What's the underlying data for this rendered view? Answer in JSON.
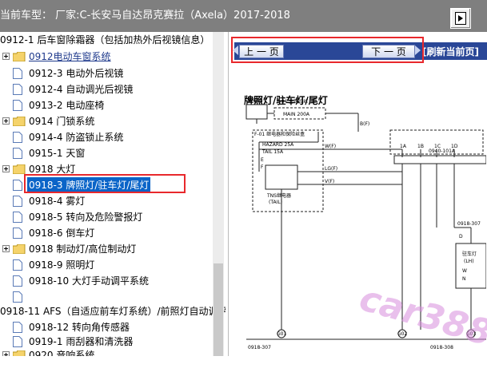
{
  "header": {
    "title": "当前车型： 厂家:C-长安马自达昂克赛拉（Axela）2017-2018",
    "action_icon": "page-export-icon"
  },
  "tree": {
    "items": [
      {
        "label": "0912-1 后车窗除霜器（包括加热外后视镜信息）",
        "type": "doc"
      },
      {
        "label": "0912电动车窗系统",
        "type": "folder"
      },
      {
        "label": "0912-3 电动外后视镜",
        "type": "doc"
      },
      {
        "label": "0912-4 自动调光后视镜",
        "type": "doc"
      },
      {
        "label": "0913-2 电动座椅",
        "type": "doc"
      },
      {
        "label": "0914 门锁系统",
        "type": "folder"
      },
      {
        "label": "0914-4 防盗锁止系统",
        "type": "doc"
      },
      {
        "label": "0915-1 天窗",
        "type": "doc"
      },
      {
        "label": "0918 大灯",
        "type": "folder"
      },
      {
        "label": "0918-3 牌照灯/驻车灯/尾灯",
        "type": "doc",
        "selected": true
      },
      {
        "label": "0918-4 雾灯",
        "type": "doc"
      },
      {
        "label": "0918-5 转向及危险警报灯",
        "type": "doc"
      },
      {
        "label": "0918-6 倒车灯",
        "type": "doc"
      },
      {
        "label": "0918 制动灯/高位制动灯",
        "type": "folder"
      },
      {
        "label": "0918-9 照明灯",
        "type": "doc"
      },
      {
        "label": "0918-10 大灯手动调平系统",
        "type": "doc"
      },
      {
        "label": "",
        "type": "doc"
      },
      {
        "label": "0918-11 AFS（自适应前车灯系统）/前照灯自动调平",
        "type": "none"
      },
      {
        "label": "0918-12 转向角传感器",
        "type": "doc"
      },
      {
        "label": "0919-1 雨刮器和清洗器",
        "type": "doc"
      },
      {
        "label": "0920 音响系统",
        "type": "folder"
      }
    ]
  },
  "viewer": {
    "prev_label": "上 一 页",
    "next_label": "下 一 页",
    "refresh_label": "[刷新当前页]",
    "diagram": {
      "title": "牌照灯/驻车灯/尾灯",
      "labels": {
        "battery": "蓄电池",
        "main_fuse": "F-04 主保险丝",
        "main_fuse_rating": "MAIN 200A",
        "fuse_block": "F-01 继电器和保险丝盒",
        "hazard": "HAZARD 25A",
        "tail": "TAIL 15A",
        "relay": "TNS继电器",
        "relay_sub": "(TAIL)",
        "wire_b": "B(F)",
        "wire_w": "W(F)",
        "wire_lg": "LG(F)",
        "wire_v": "V(F)",
        "conn_0940": "0940-101A",
        "conn_0918_307": "0918-307",
        "lamp": "驻车灯",
        "lamp_side": "(LH)",
        "lamp_w": "W",
        "lamp_n": "N",
        "ground_1": "G01",
        "ground_2": "G02",
        "ground_3": "G03",
        "bottom_left": "0918-307",
        "bottom_right": "0918-308",
        "pin_1a": "1A",
        "pin_1b": "1B",
        "pin_1c": "1C",
        "pin_1d": "1D",
        "pin_d": "D",
        "pin_e": "E",
        "pin_f": "F"
      }
    },
    "watermark": "car388.com"
  }
}
